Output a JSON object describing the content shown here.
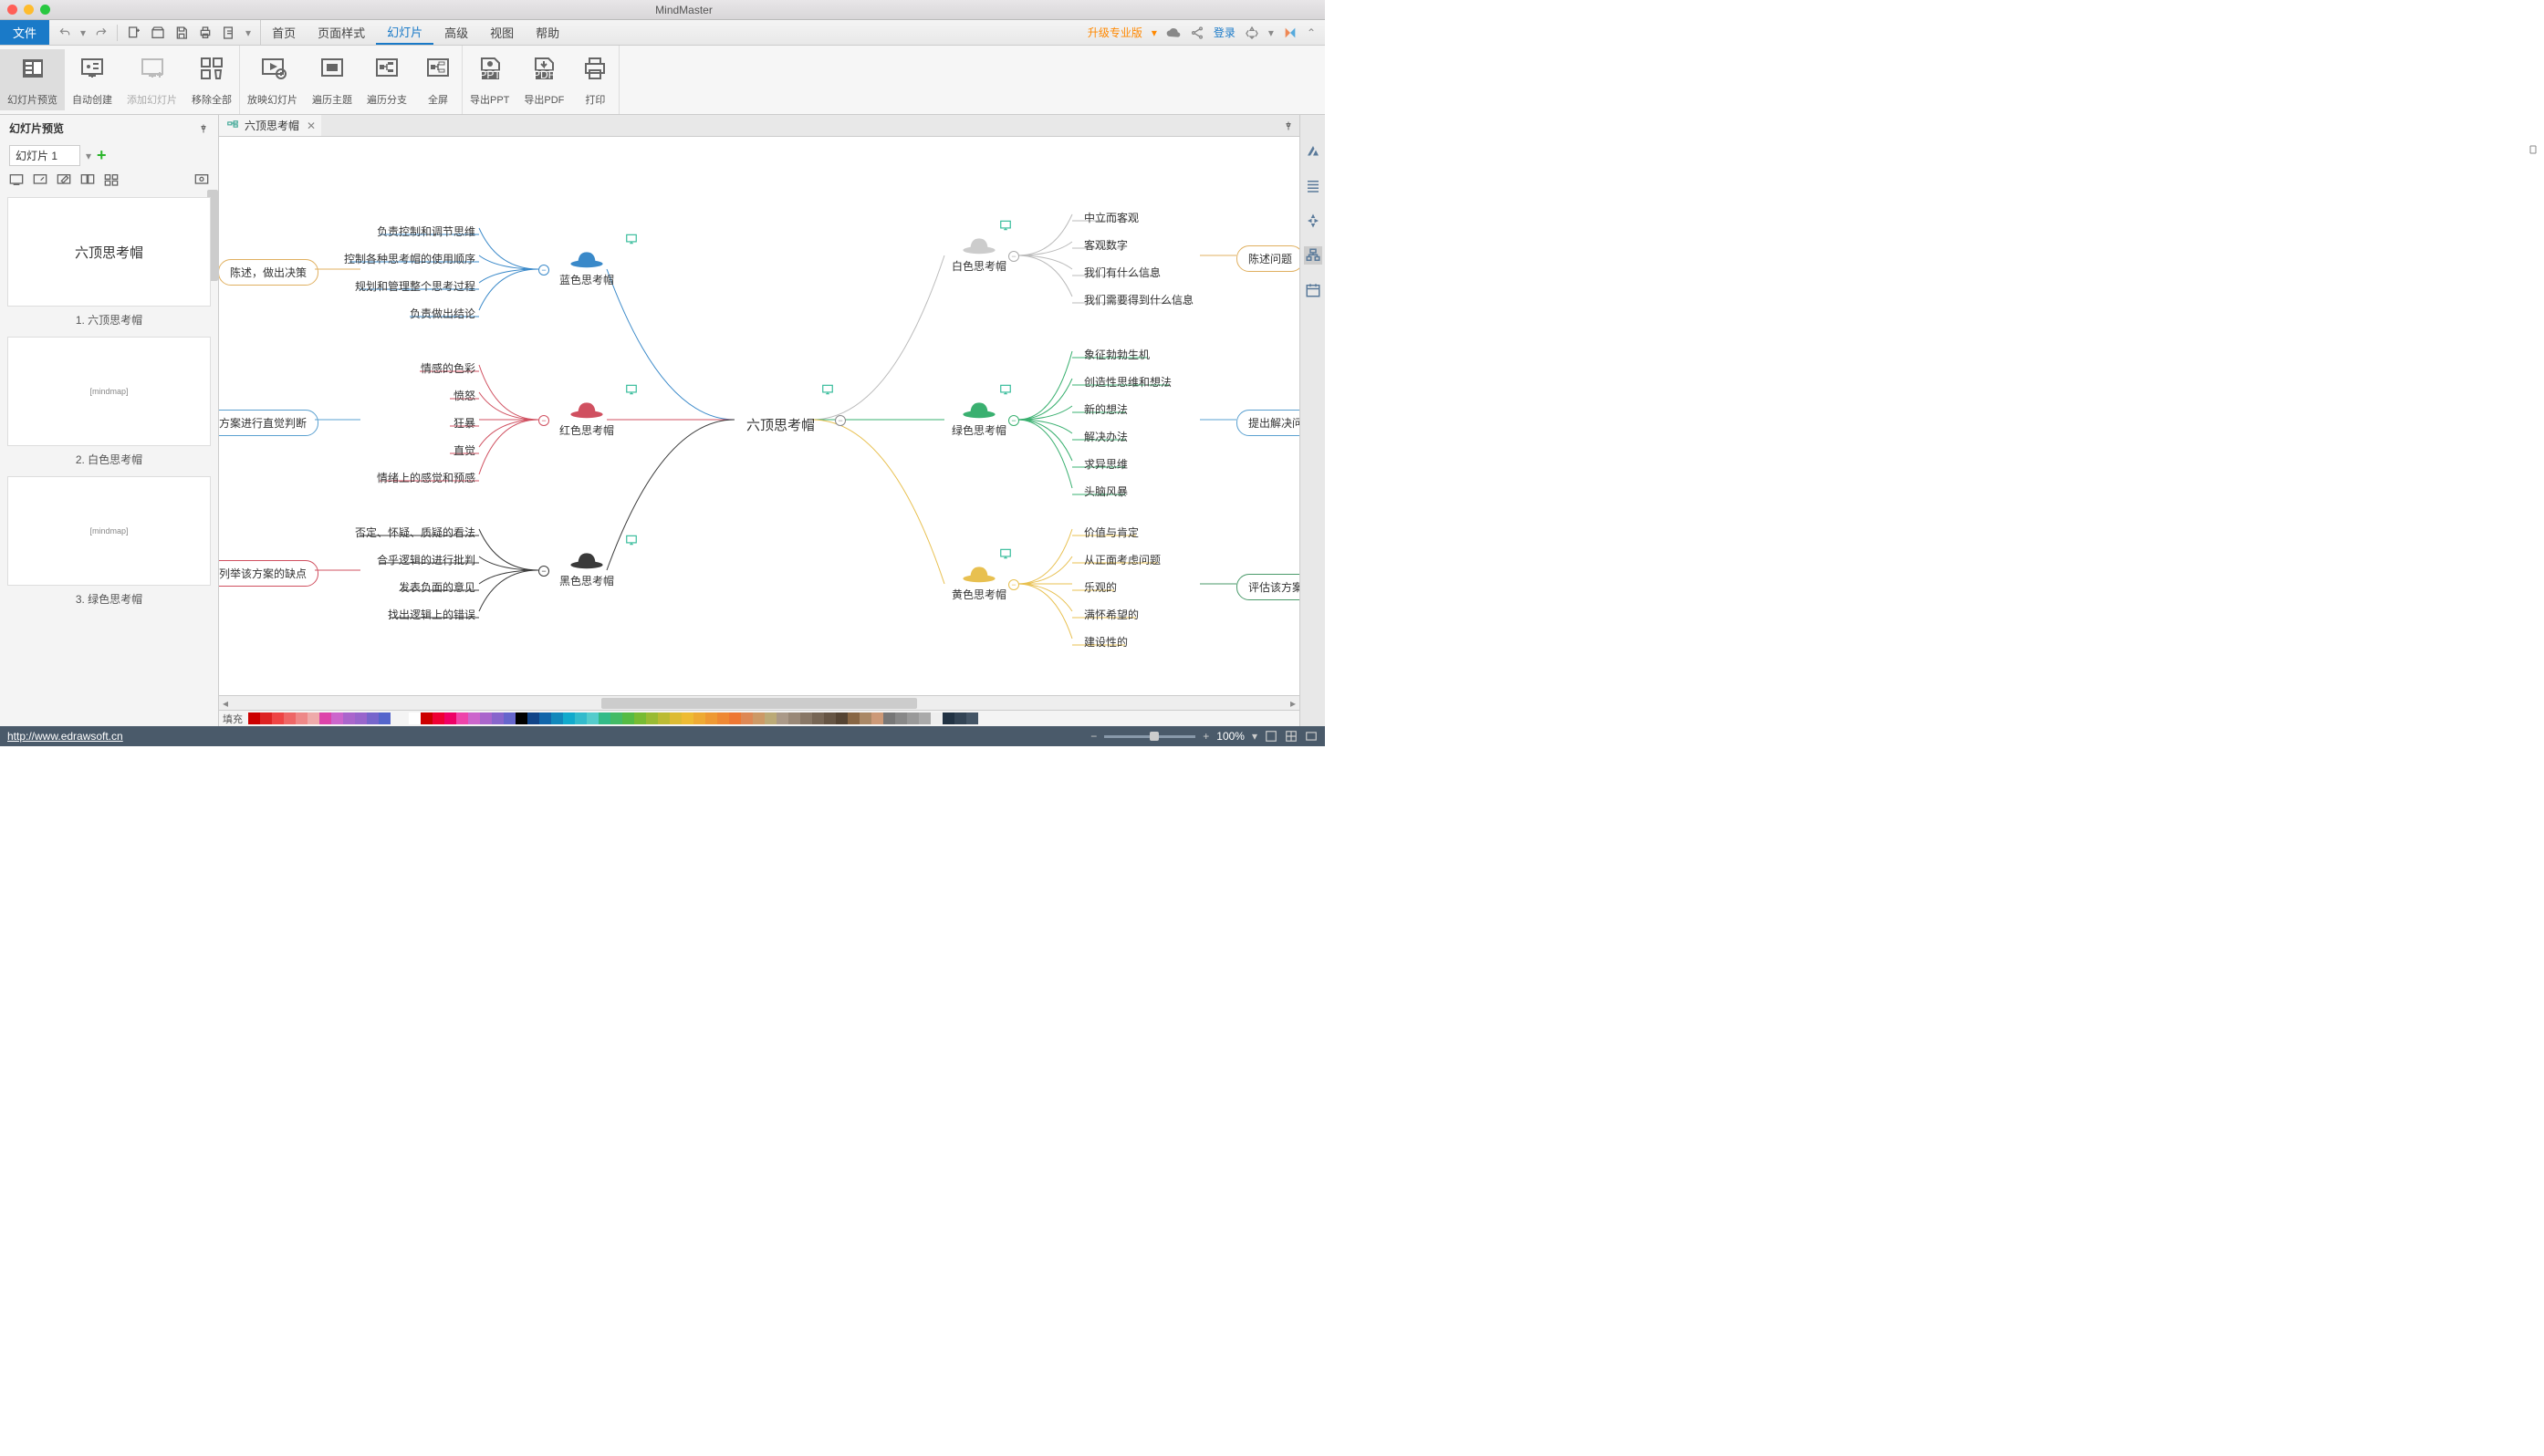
{
  "app_title": "MindMaster",
  "file_btn": "文件",
  "menu_tabs": [
    "首页",
    "页面样式",
    "幻灯片",
    "高级",
    "视图",
    "帮助"
  ],
  "menu_active": 2,
  "upgrade": "升级专业版",
  "login": "登录",
  "ribbon": {
    "g1": [
      {
        "label": "幻灯片预览",
        "active": true
      },
      {
        "label": "自动创建"
      },
      {
        "label": "添加幻灯片",
        "disabled": true
      },
      {
        "label": "移除全部"
      }
    ],
    "g2": [
      {
        "label": "放映幻灯片"
      },
      {
        "label": "遍历主题"
      },
      {
        "label": "遍历分支"
      },
      {
        "label": "全屏"
      }
    ],
    "g3": [
      {
        "label": "导出PPT"
      },
      {
        "label": "导出PDF"
      },
      {
        "label": "打印"
      }
    ]
  },
  "side": {
    "title": "幻灯片预览",
    "slide_select": "幻灯片 1",
    "thumbs": [
      {
        "label": "1. 六顶思考帽",
        "title": "六顶思考帽"
      },
      {
        "label": "2. 白色思考帽"
      },
      {
        "label": "3. 绿色思考帽"
      }
    ]
  },
  "doc_tab": "六顶思考帽",
  "mindmap": {
    "center": "六顶思考帽",
    "left": [
      {
        "name": "蓝色思考帽",
        "color": "#3a89c9",
        "box": "陈述，做出决策",
        "box_color": "#e0b060",
        "children": [
          "负责控制和调节思维",
          "控制各种思考帽的使用顺序",
          "规划和管理整个思考过程",
          "负责做出结论"
        ]
      },
      {
        "name": "红色思考帽",
        "color": "#d05060",
        "box": "对该方案进行直觉判断",
        "box_color": "#5aa0d0",
        "children": [
          "情感的色彩",
          "愤怒",
          "狂暴",
          "直觉",
          "情绪上的感觉和预感"
        ]
      },
      {
        "name": "黑色思考帽",
        "color": "#3a3a3a",
        "box": "列举该方案的缺点",
        "box_color": "#d05060",
        "children": [
          "否定、怀疑、质疑的看法",
          "合乎逻辑的进行批判",
          "发表负面的意见",
          "找出逻辑上的错误"
        ]
      }
    ],
    "right": [
      {
        "name": "白色思考帽",
        "color": "#cccccc",
        "box": "陈述问题",
        "box_color": "#e0b060",
        "children": [
          "中立而客观",
          "客观数字",
          "我们有什么信息",
          "我们需要得到什么信息"
        ]
      },
      {
        "name": "绿色思考帽",
        "color": "#3ab070",
        "box": "提出解决问题的方",
        "box_color": "#5aa0d0",
        "children": [
          "象征勃勃生机",
          "创造性思维和想法",
          "新的想法",
          "解决办法",
          "求异思维",
          "头脑风暴"
        ]
      },
      {
        "name": "黄色思考帽",
        "color": "#e8c050",
        "box": "评估该方案的优点",
        "box_color": "#4a9a6a",
        "children": [
          "价值与肯定",
          "从正面考虑问题",
          "乐观的",
          "满怀希望的",
          "建设性的"
        ]
      }
    ]
  },
  "fill_label": "填充",
  "status": {
    "url": "http://www.edrawsoft.cn",
    "zoom": "100%"
  }
}
